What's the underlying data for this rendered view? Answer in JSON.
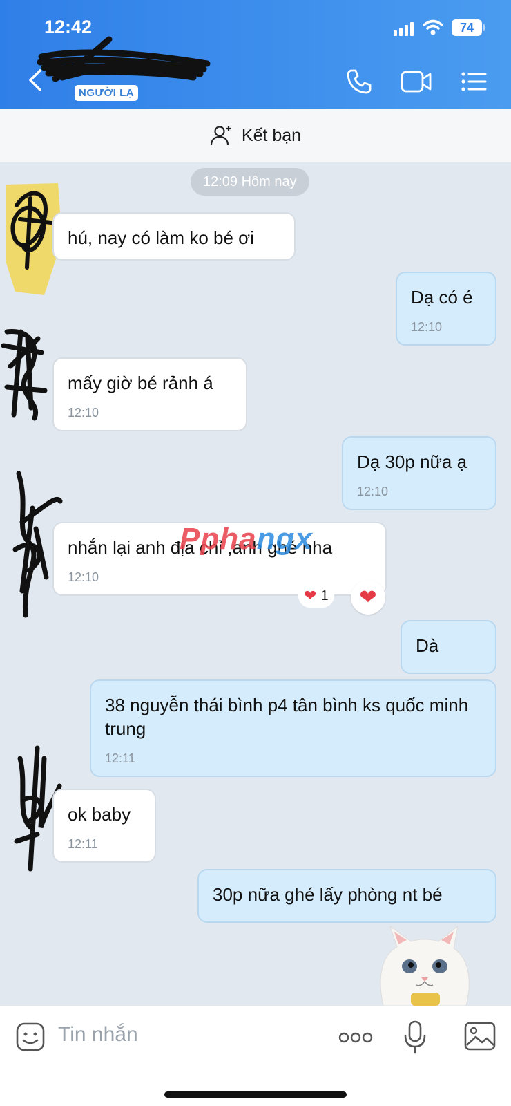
{
  "status": {
    "time": "12:42",
    "battery": "74"
  },
  "header": {
    "badge": "NGƯỜI LẠ"
  },
  "add_friend": {
    "label": "Kết bạn"
  },
  "chat": {
    "date_label": "12:09 Hôm nay",
    "messages": [
      {
        "dir": "in",
        "text": "hú, nay có làm ko bé ơi",
        "time": ""
      },
      {
        "dir": "out",
        "text": "Dạ có é",
        "time": "12:10"
      },
      {
        "dir": "in",
        "text": "mấy giờ bé rảnh á",
        "time": "12:10"
      },
      {
        "dir": "out",
        "text": "Dạ 30p nữa ạ",
        "time": "12:10"
      },
      {
        "dir": "in",
        "text": "nhắn lại anh địa chỉ ,anh ghé nha",
        "time": "12:10",
        "reaction_count": "1"
      },
      {
        "dir": "out",
        "text": "Dà",
        "time": ""
      },
      {
        "dir": "out",
        "text": "38 nguyễn thái bình p4 tân bình ks quốc minh trung",
        "time": "12:11"
      },
      {
        "dir": "in",
        "text": "ok baby",
        "time": "12:11"
      },
      {
        "dir": "out",
        "text": "30p nữa ghé lấy phòng nt bé",
        "time": ""
      }
    ]
  },
  "watermark": {
    "part1": "Ppha",
    "part2": "ngx"
  },
  "composer": {
    "placeholder": "Tin nhắn"
  },
  "colors": {
    "header": "#2f7fe8",
    "bubble_out": "#d5ecfc",
    "bubble_in": "#ffffff",
    "chat_bg": "#e2e8ef"
  }
}
